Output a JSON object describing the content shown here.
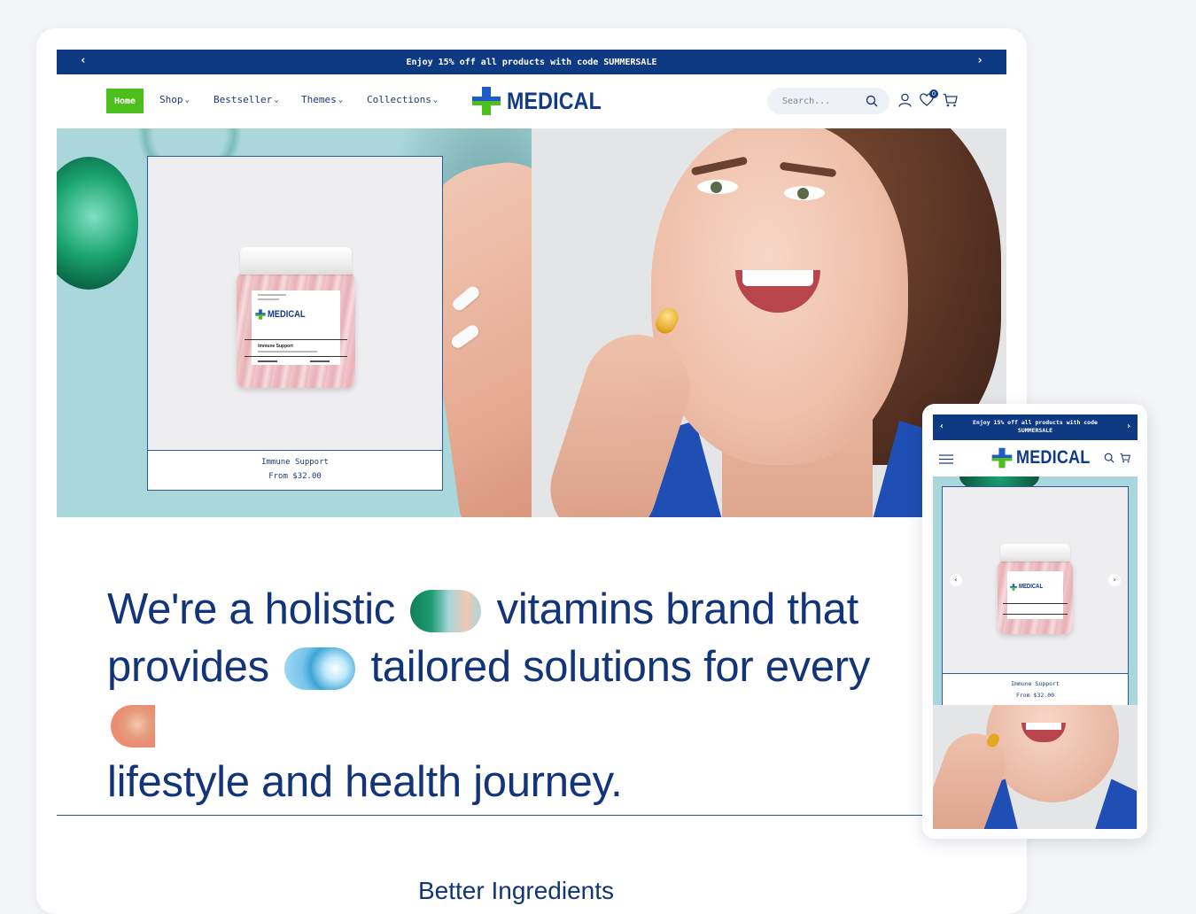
{
  "announcement": {
    "text": "Enjoy 15% off all products with code SUMMERSALE",
    "prev": "‹",
    "next": "›"
  },
  "nav": {
    "home": "Home",
    "items": [
      {
        "label": "Shop",
        "chevron": "⌄"
      },
      {
        "label": "Bestseller",
        "chevron": "⌄"
      },
      {
        "label": "Themes",
        "chevron": "⌄"
      },
      {
        "label": "Collections",
        "chevron": "⌄"
      }
    ]
  },
  "brand": {
    "name": "MEDICAL",
    "colors": {
      "primary": "#103b86",
      "accent": "#4cbf1c",
      "cross_blue": "#1d5cc8"
    }
  },
  "search": {
    "placeholder": "Search..."
  },
  "header_icons": {
    "account": "user-icon",
    "wishlist": "heart-icon",
    "wishlist_count": "0",
    "cart": "cart-icon"
  },
  "product_card": {
    "name": "Immune Support",
    "price": "From $32.00",
    "jar_label": {
      "brand": "MEDICAL",
      "product": "Immune Support"
    }
  },
  "headline": {
    "line1_a": "We're a holistic",
    "line1_b": "vitamins brand that",
    "line2_a": "provides",
    "line2_b": "tailored solutions for every",
    "line3": "lifestyle and health journey."
  },
  "section": {
    "title": "Better Ingredients"
  },
  "mobile": {
    "announcement": "Enjoy 15% off all products with code SUMMERSALE",
    "brand": "MEDICAL",
    "card_name": "Immune Support",
    "card_price": "From $32.00",
    "prev": "‹",
    "next": "›"
  }
}
